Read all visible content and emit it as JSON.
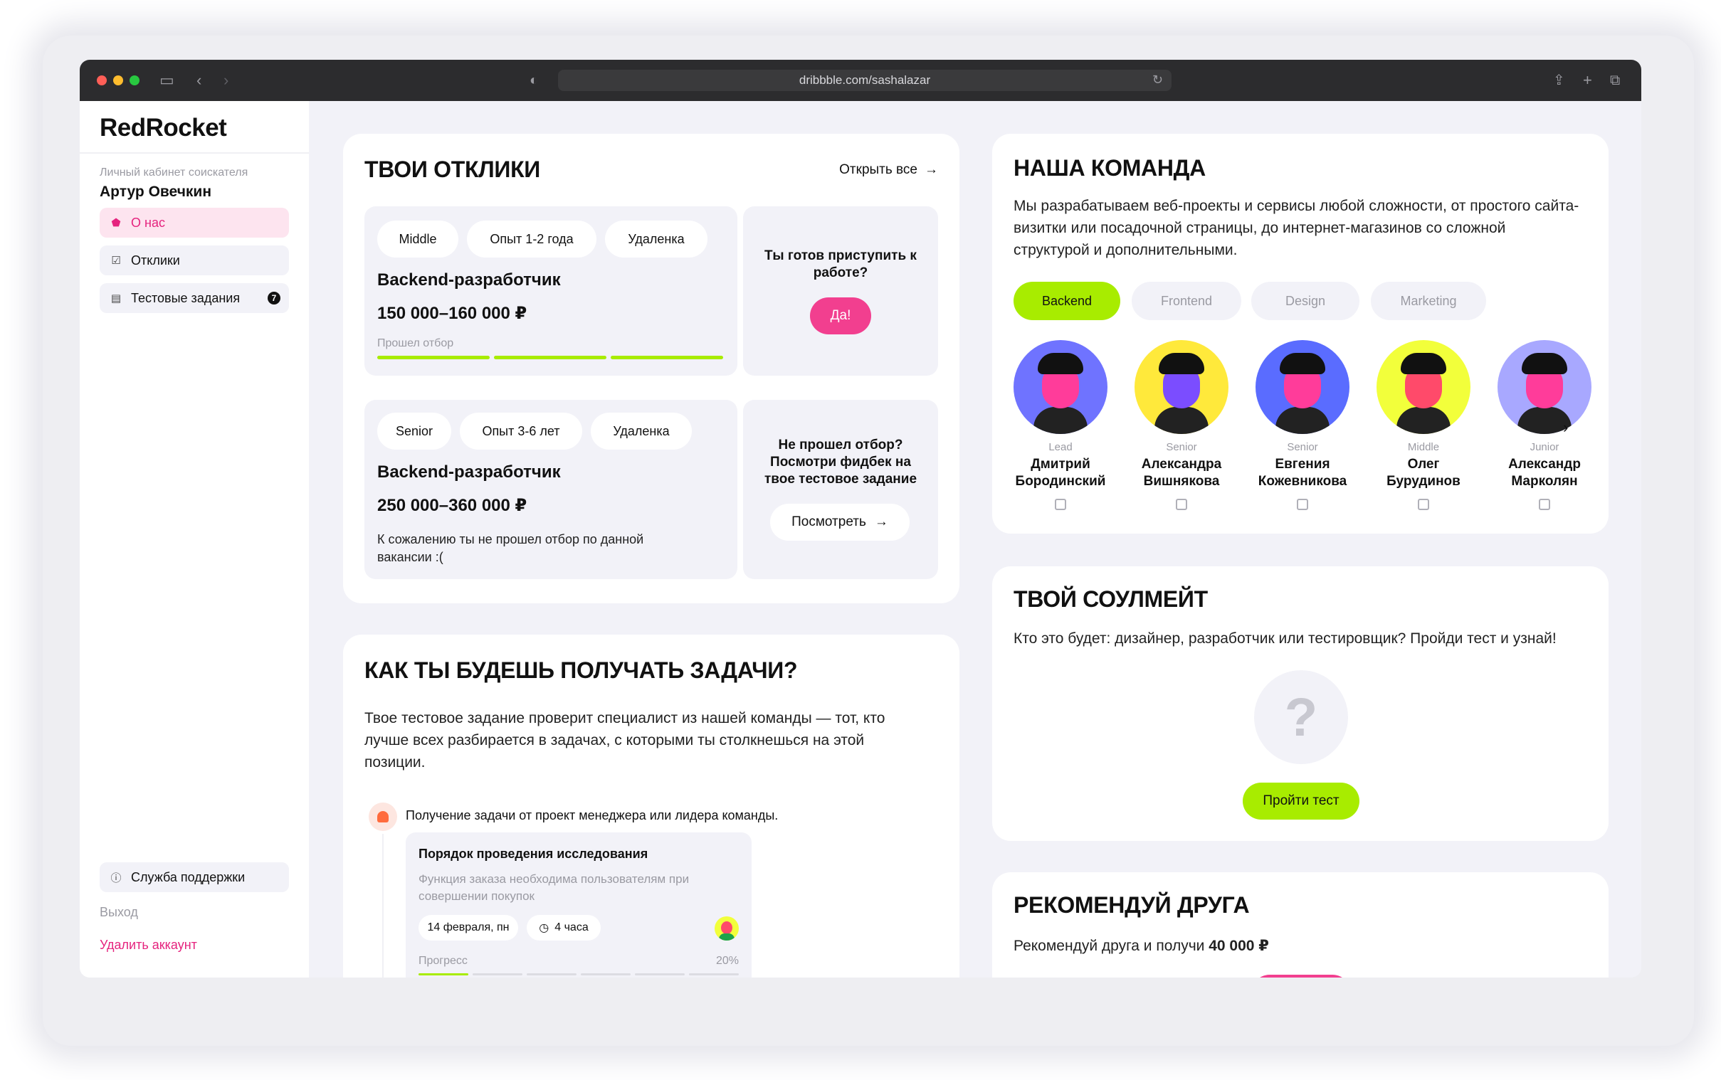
{
  "browser": {
    "url": "dribbble.com/sashalazar"
  },
  "sidebar": {
    "logo": "RedRocket",
    "cabinet_label": "Личный кабинет соискателя",
    "user_name": "Артур Овечкин",
    "items": [
      {
        "label": "О нас",
        "icon": "home-icon",
        "active": true
      },
      {
        "label": "Отклики",
        "icon": "checkbox-icon",
        "active": false
      },
      {
        "label": "Тестовые задания",
        "icon": "clipboard-icon",
        "active": false,
        "badge": "7"
      }
    ],
    "support": "Служба поддержки",
    "logout": "Выход",
    "delete_account": "Удалить аккаунт"
  },
  "responses": {
    "title": "ТВОИ ОТКЛИКИ",
    "open_all": "Открыть все",
    "jobs": [
      {
        "tags": [
          "Middle",
          "Опыт 1-2 года",
          "Удаленка"
        ],
        "title": "Backend-разработчик",
        "salary": "150 000–160 000 ₽",
        "status": "Прошел отбор",
        "side_question": "Ты готов приступить к работе?",
        "side_button": "Да!"
      },
      {
        "tags": [
          "Senior",
          "Опыт 3-6 лет",
          "Удаленка"
        ],
        "title": "Backend-разработчик",
        "salary": "250 000–360 000 ₽",
        "status": "К сожалению ты не прошел отбор по данной вакансии :(",
        "side_question": "Не прошел отбор? Посмотри фидбек на твое тестовое задание",
        "side_button": "Посмотреть"
      }
    ]
  },
  "tasks": {
    "title": "КАК ТЫ БУДЕШЬ ПОЛУЧАТЬ ЗАДАЧИ?",
    "text": "Твое тестовое задание проверит специалист из нашей команды — тот, кто лучше всех разбирается в задачах, с которыми ты столкнешься на этой позиции.",
    "step_label": "Получение задачи от проект менеджера или лидера команды.",
    "task_card": {
      "title": "Порядок проведения исследования",
      "description": "Функция заказа необходима пользователям при совершении покупок",
      "date": "14 февраля, пн",
      "duration": "4 часа",
      "progress_label": "Прогресс",
      "progress_value": "20%",
      "progress_fraction": 0.2
    }
  },
  "team": {
    "title": "НАША КОМАНДА",
    "text": "Мы разрабатываем веб-проекты и сервисы любой сложности, от простого сайта-визитки или посадочной страницы, до интернет-магазинов со сложной структурой и дополнительными.",
    "filters": [
      {
        "label": "Backend",
        "active": true
      },
      {
        "label": "Frontend",
        "active": false
      },
      {
        "label": "Design",
        "active": false
      },
      {
        "label": "Marketing",
        "active": false
      }
    ],
    "members": [
      {
        "level": "Lead",
        "first": "Дмитрий",
        "last": "Бородинский",
        "bg": "#6f73ff",
        "skin": "#ff3c9a",
        "hair": "#111111"
      },
      {
        "level": "Senior",
        "first": "Александра",
        "last": "Вишнякова",
        "bg": "#ffe93b",
        "skin": "#7b4dff",
        "hair": "#111111"
      },
      {
        "level": "Senior",
        "first": "Евгения",
        "last": "Кожевникова",
        "bg": "#5a6cff",
        "skin": "#ff3c9a",
        "hair": "#111111"
      },
      {
        "level": "Middle",
        "first": "Олег",
        "last": "Бурудинов",
        "bg": "#f2ff3b",
        "skin": "#ff4a6a",
        "hair": "#111111"
      },
      {
        "level": "Junior",
        "first": "Александр",
        "last": "Марколян",
        "bg": "#a8a8ff",
        "skin": "#ff3c9a",
        "hair": "#111111"
      }
    ]
  },
  "soulmate": {
    "title": "ТВОЙ СОУЛМЕЙТ",
    "text": "Кто это будет: дизайнер, разработчик или тестировщик? Пройди тест и узнай!",
    "button": "Пройти тест",
    "placeholder": "?"
  },
  "recommend": {
    "title": "РЕКОМЕНДУЙ ДРУГА",
    "text_prefix": "Рекомендуй друга и получи",
    "amount": "40 000 ₽"
  },
  "colors": {
    "accent_pink": "#f23f8f",
    "accent_lime": "#a8ec00",
    "background": "#f2f2f8"
  }
}
